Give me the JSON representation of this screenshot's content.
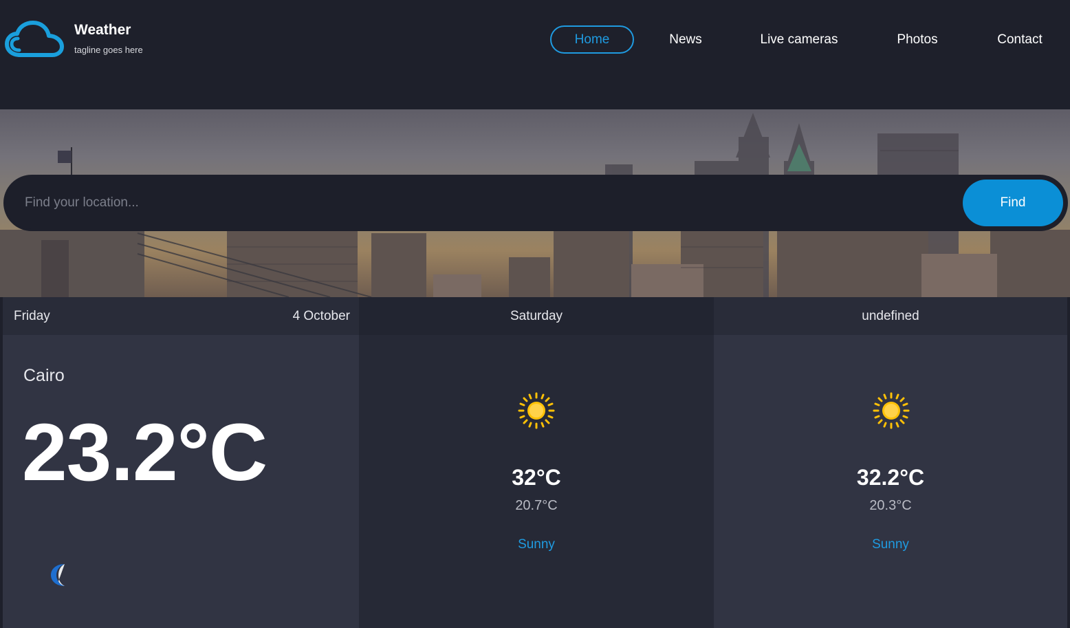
{
  "brand": {
    "title": "Weather",
    "tagline": "tagline goes here",
    "icon": "cloud-icon"
  },
  "nav": {
    "items": [
      {
        "label": "Home",
        "active": true
      },
      {
        "label": "News",
        "active": false
      },
      {
        "label": "Live cameras",
        "active": false
      },
      {
        "label": "Photos",
        "active": false
      },
      {
        "label": "Contact",
        "active": false
      }
    ]
  },
  "search": {
    "placeholder": "Find your location...",
    "value": "",
    "button_label": "Find"
  },
  "today": {
    "day": "Friday",
    "date": "4 October",
    "city": "Cairo",
    "temperature": "23.2°C",
    "icon": "moon-icon"
  },
  "forecast": [
    {
      "day": "Saturday",
      "max": "32°C",
      "min": "20.7°C",
      "condition": "Sunny",
      "icon": "sun-icon"
    },
    {
      "day": "undefined",
      "max": "32.2°C",
      "min": "20.3°C",
      "condition": "Sunny",
      "icon": "sun-icon"
    }
  ],
  "colors": {
    "accent": "#1f9be1",
    "background": "#1e202b",
    "card": "#313443",
    "sun": "#ffc107"
  }
}
